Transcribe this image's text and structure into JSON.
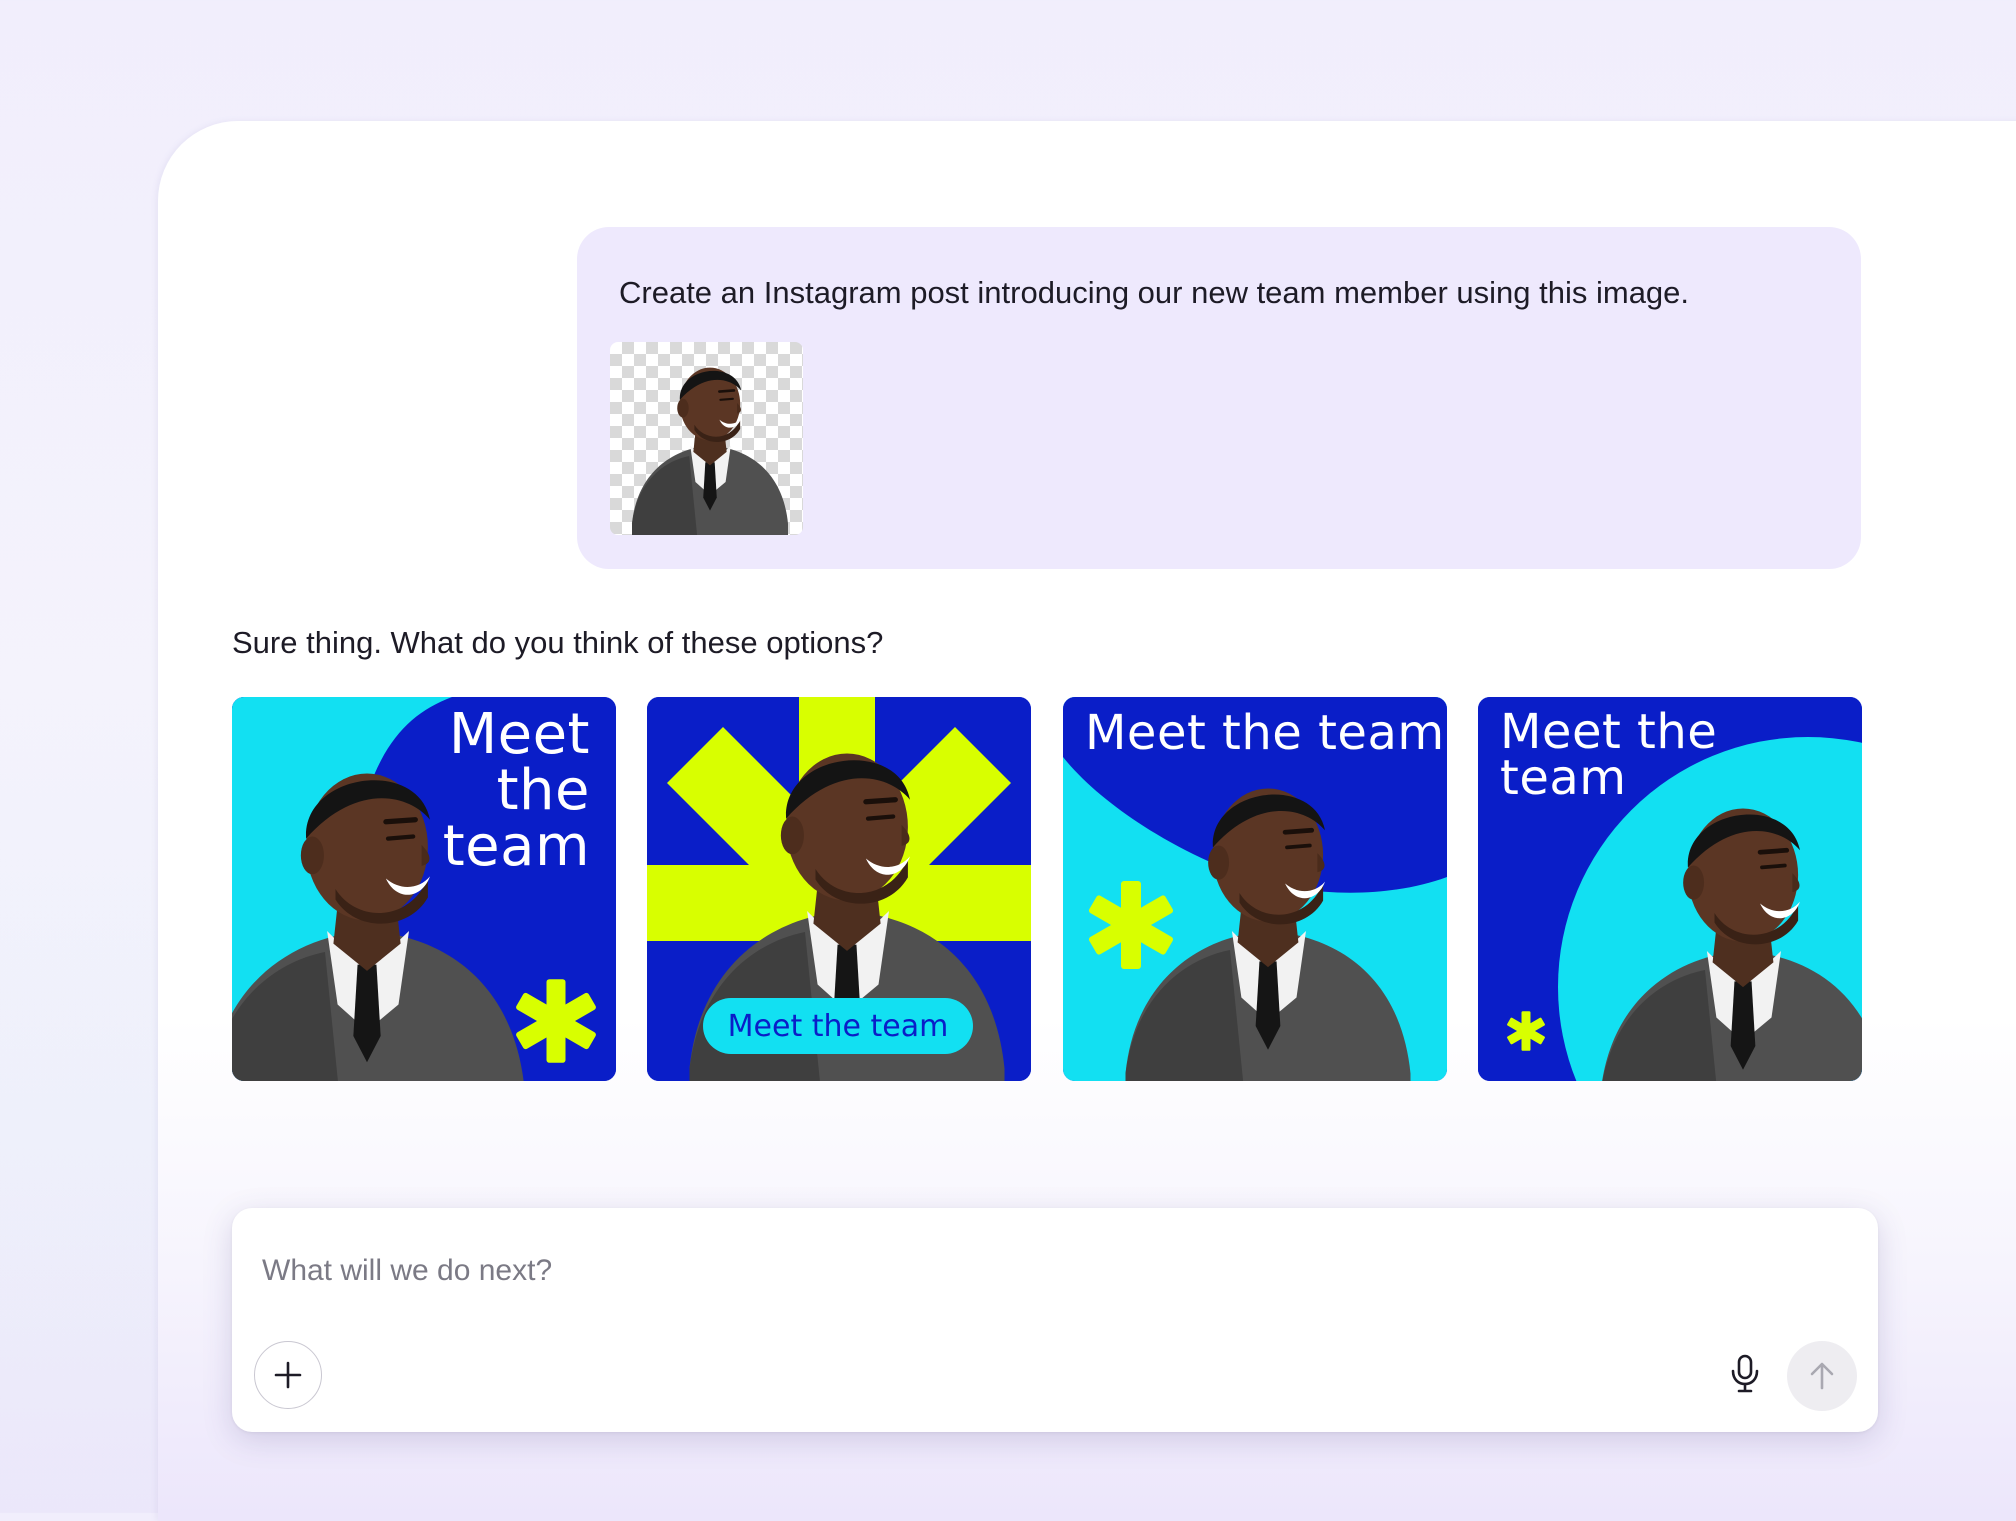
{
  "conversation": {
    "user_message": "Create an Instagram post introducing our new team member using this image.",
    "assistant_reply": "Sure thing. What do you think of these options?"
  },
  "options": [
    {
      "title_lines": [
        "Meet",
        "the",
        "team"
      ]
    },
    {
      "pill": "Meet the team"
    },
    {
      "title": "Meet the team"
    },
    {
      "title_lines": [
        "Meet the",
        "team"
      ]
    }
  ],
  "composer": {
    "placeholder": "What will we do next?",
    "value": ""
  },
  "icons": {
    "add": "plus-icon",
    "mic": "microphone-icon",
    "send": "arrow-up-icon",
    "decoration": "asterisk-star"
  },
  "colors": {
    "bubble": "#eee9fd",
    "brand_blue": "#0a1ec8",
    "cyan": "#12e0f2",
    "lime": "#d8ff00"
  }
}
